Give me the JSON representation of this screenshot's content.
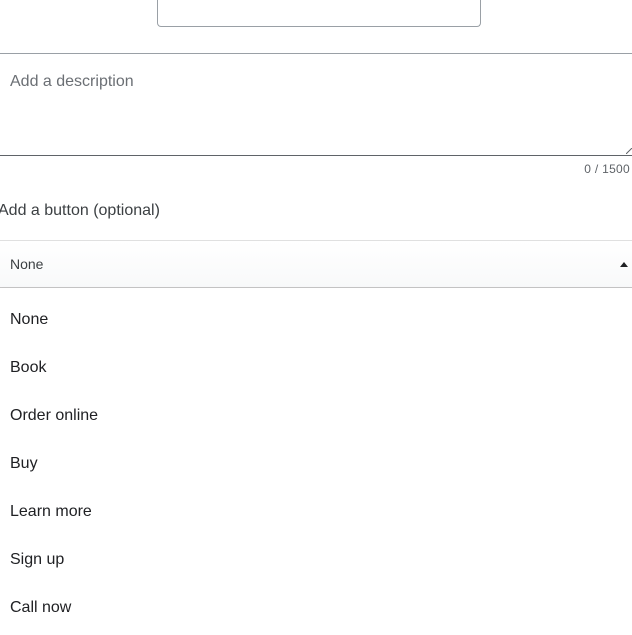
{
  "description": {
    "placeholder": "Add a description",
    "value": "",
    "counter": "0 / 1500"
  },
  "button_section": {
    "label": "Add a button (optional)",
    "selected": "None",
    "options": [
      "None",
      "Book",
      "Order online",
      "Buy",
      "Learn more",
      "Sign up",
      "Call now"
    ]
  },
  "icons": {
    "dropdown": "caret-up-icon",
    "resize": "resize-handle-icon"
  },
  "colors": {
    "border": "#9aa0a6",
    "text": "#202124",
    "muted": "#6b6f74"
  }
}
